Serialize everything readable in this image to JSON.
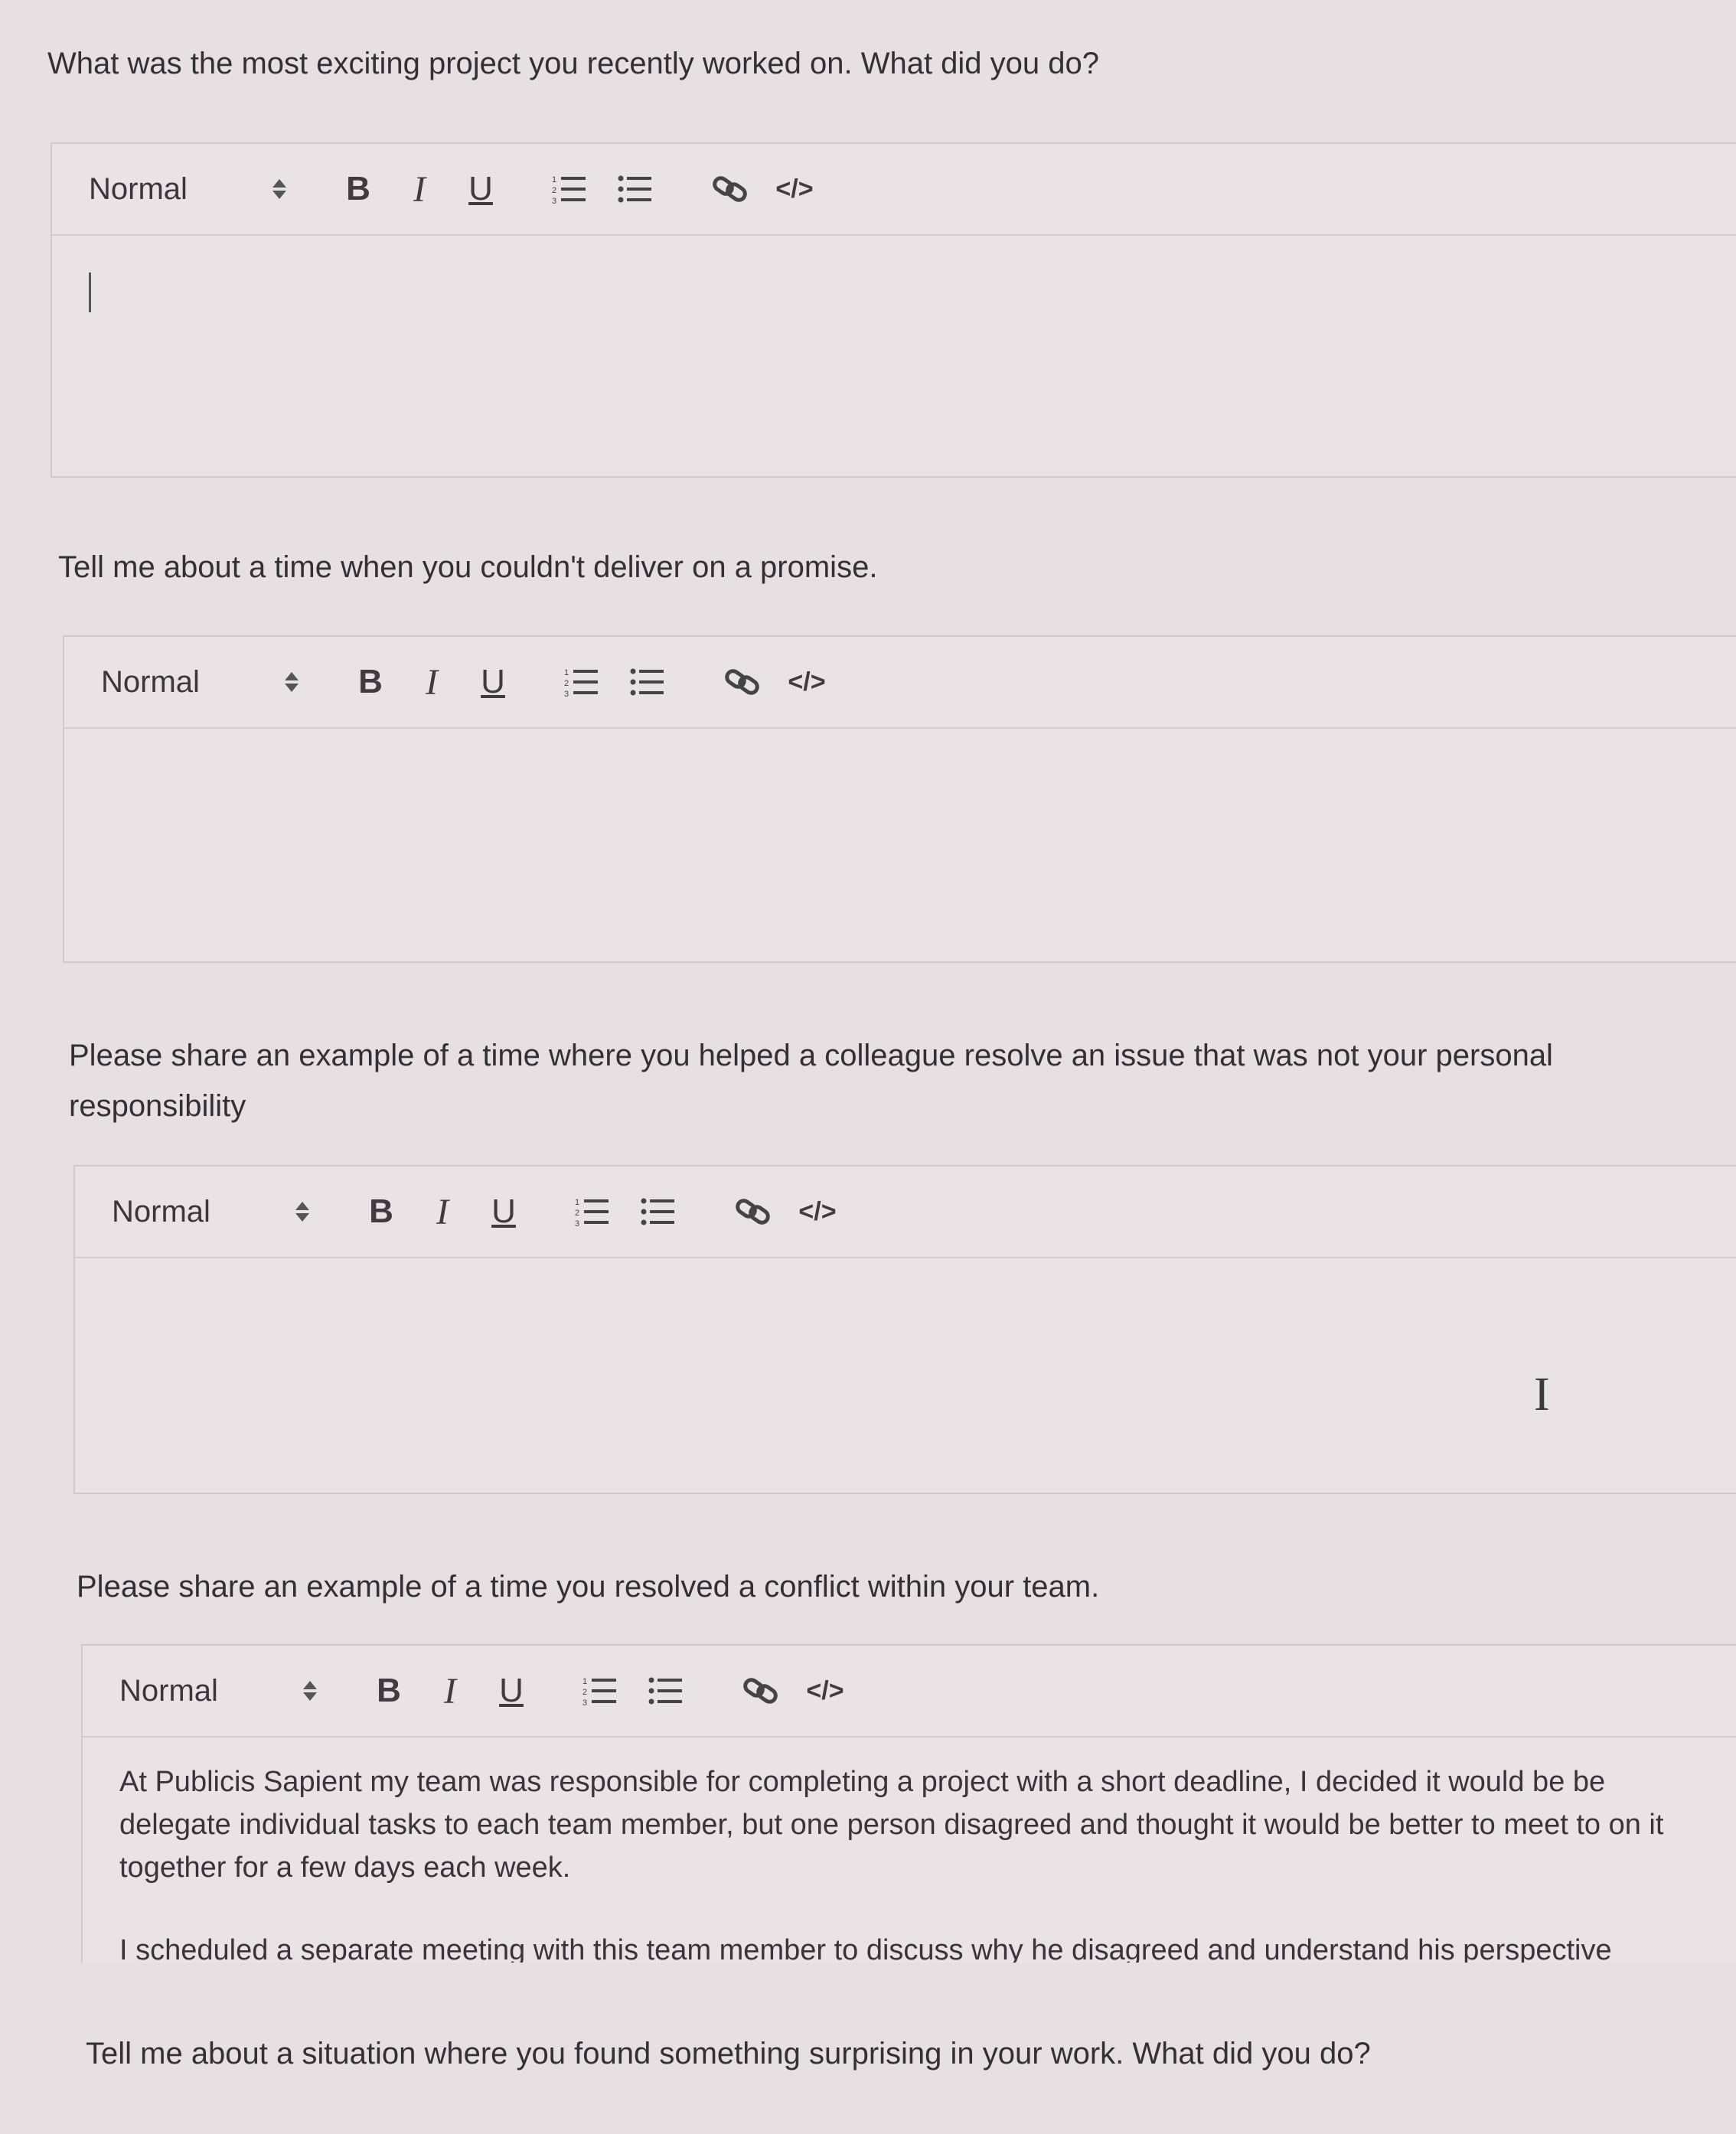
{
  "questions": [
    {
      "label": "What was the most exciting project you recently worked on. What did you do?",
      "toolbar": {
        "format": "Normal"
      },
      "answer": []
    },
    {
      "label": "Tell me about a time when you couldn't deliver on a promise.",
      "toolbar": {
        "format": "Normal"
      },
      "answer": []
    },
    {
      "label": "Please share an example of a time where you helped a colleague resolve an issue that was not your personal responsibility",
      "toolbar": {
        "format": "Normal"
      },
      "answer": []
    },
    {
      "label": "Please share an example of a time you resolved a conflict within your team.",
      "toolbar": {
        "format": "Normal"
      },
      "answer": [
        "At Publicis Sapient my team was responsible for completing a project with a short deadline, I decided it would be be delegate individual tasks to each team member, but one person disagreed and thought it would be better to meet to on it together for a few days each week.",
        "I scheduled a separate meeting with this team member to discuss why he disagreed and understand his perspective"
      ]
    },
    {
      "label": "Tell me about a situation where you found something surprising in your work. What did you do?",
      "toolbar": {
        "format": "Normal"
      },
      "answer": []
    }
  ],
  "icons": {
    "bold": "B",
    "italic": "I",
    "underline": "U",
    "ordered_list": "ordered-list-icon",
    "bullet_list": "bullet-list-icon",
    "link": "link-icon",
    "code": "</>"
  }
}
